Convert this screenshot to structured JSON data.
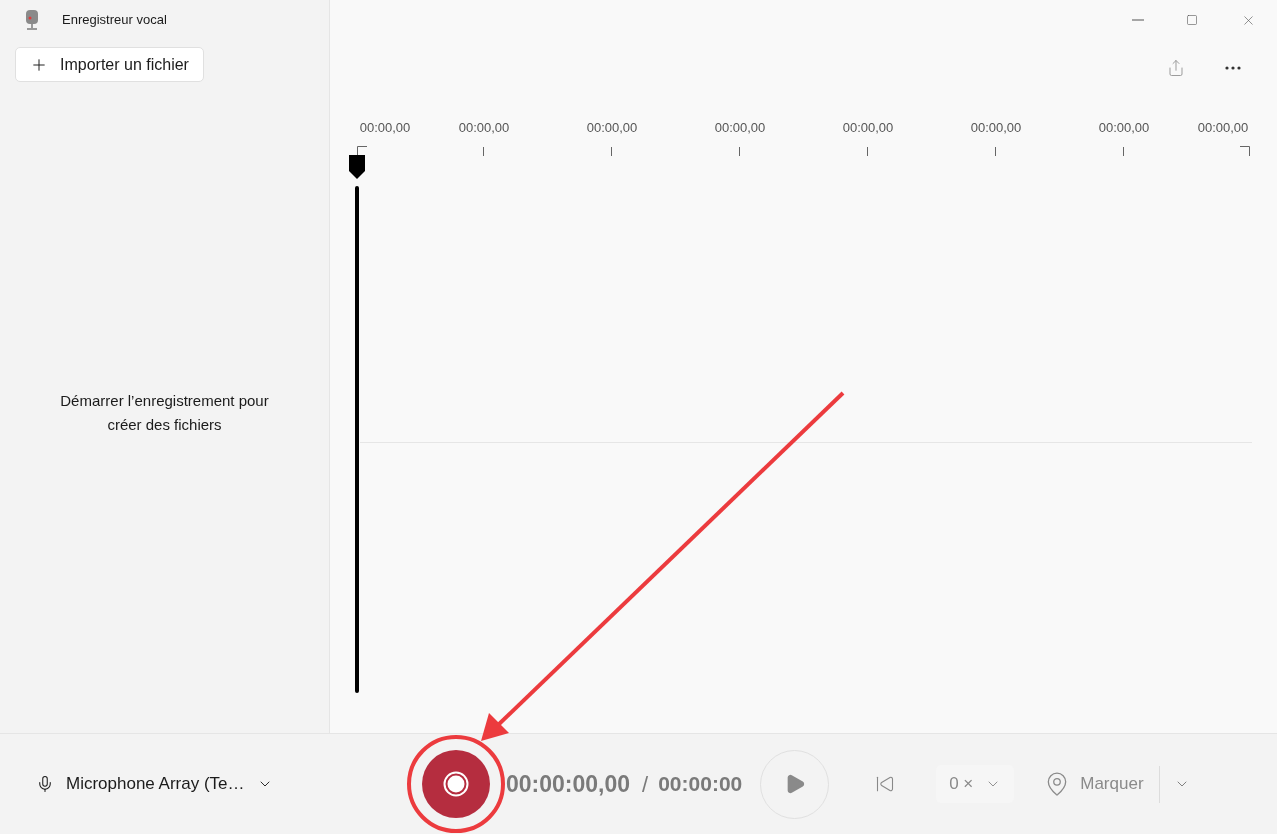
{
  "window": {
    "title": "Enregistreur vocal"
  },
  "sidebar": {
    "import_button": "Importer un fichier",
    "empty_message": "Démarrer l’enregistrement pour créer des fichiers"
  },
  "timeline": {
    "labels": [
      "00:00,00",
      "00:00,00",
      "00:00,00",
      "00:00,00",
      "00:00,00",
      "00:00,00",
      "00:00,00",
      "00:00,00"
    ]
  },
  "controls": {
    "microphone": "Microphone Array (Te…",
    "elapsed": "00:00:00,00",
    "separator": "/",
    "duration": "00:00:00",
    "speed": "0 ×",
    "marker_button": "Marquer"
  }
}
